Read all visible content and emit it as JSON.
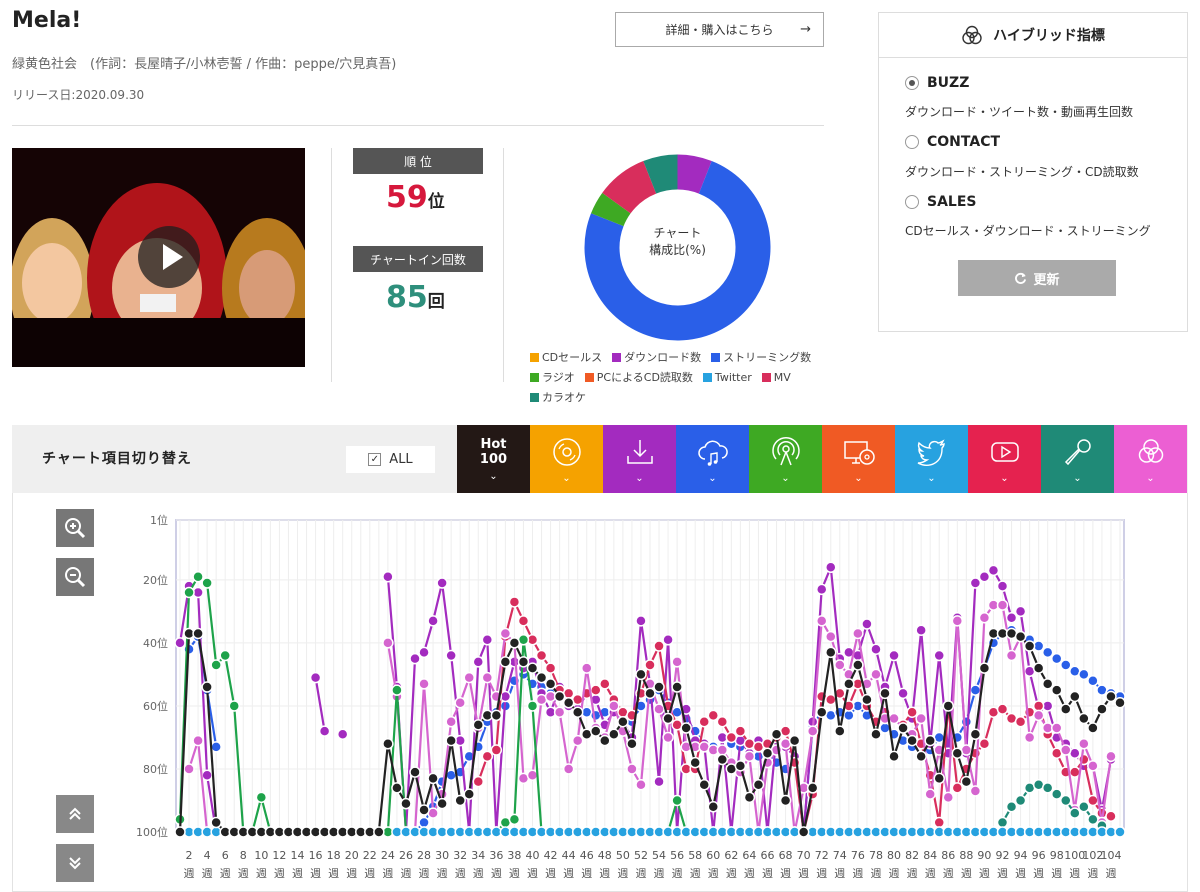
{
  "song": {
    "title": "Mela!",
    "credits": "緑黄色社会　(作詞：長屋晴子/小林壱誓 / 作曲：peppe/穴見真吾)",
    "release": "リリース日:2020.09.30",
    "detail_button": "詳細・購入はこちら",
    "detail_arrow": "→"
  },
  "stats": {
    "rank_label": "順 位",
    "rank_value": "59",
    "rank_unit": "位",
    "chartin_label": "チャートイン回数",
    "chartin_value": "85",
    "chartin_unit": "回",
    "rank_color": "#d6183c",
    "chartin_color": "#2e8f7c"
  },
  "composition": {
    "center_line1": "チャート",
    "center_line2": "構成比(%)",
    "slices": [
      {
        "name": "CDセールス",
        "value": 0,
        "color": "#f5a200"
      },
      {
        "name": "ダウンロード数",
        "value": 6,
        "color": "#a32bbf"
      },
      {
        "name": "ストリーミング数",
        "value": 75,
        "color": "#2a5fe8"
      },
      {
        "name": "ラジオ",
        "value": 4,
        "color": "#3ea923"
      },
      {
        "name": "PCによるCD読取数",
        "value": 0,
        "color": "#f05a24"
      },
      {
        "name": "Twitter",
        "value": 0,
        "color": "#27a2e0"
      },
      {
        "name": "MV",
        "value": 9,
        "color": "#d82e5c"
      },
      {
        "name": "カラオケ",
        "value": 6,
        "color": "#1f8a77"
      }
    ]
  },
  "hybrid": {
    "title": "ハイブリッド指標",
    "options": [
      {
        "label": "BUZZ",
        "desc": "ダウンロード・ツイート数・動画再生回数",
        "selected": true
      },
      {
        "label": "CONTACT",
        "desc": "ダウンロード・ストリーミング・CD読取数",
        "selected": false
      },
      {
        "label": "SALES",
        "desc": "CDセールス・ダウンロード・ストリーミング",
        "selected": false
      }
    ],
    "refresh": "更新"
  },
  "toolbar": {
    "switch_label": "チャート項目切り替え",
    "all_label": "ALL",
    "all_check": "✓",
    "hot_line1": "Hot",
    "hot_line2": "100",
    "chevron": "⌄",
    "tabs": [
      {
        "name": "hot100",
        "color": "#231815",
        "icon": "hot100"
      },
      {
        "name": "cd-sales",
        "color": "#f5a200",
        "icon": "disc-icon"
      },
      {
        "name": "download",
        "color": "#a32bbf",
        "icon": "download-icon"
      },
      {
        "name": "streaming",
        "color": "#2a5fe8",
        "icon": "cloud-music-icon"
      },
      {
        "name": "radio",
        "color": "#3ea923",
        "icon": "radio-icon"
      },
      {
        "name": "pc-cd-read",
        "color": "#f05a24",
        "icon": "pc-disc-icon"
      },
      {
        "name": "twitter",
        "color": "#27a2e0",
        "icon": "twitter-icon"
      },
      {
        "name": "mv",
        "color": "#e5224f",
        "icon": "video-play-icon"
      },
      {
        "name": "karaoke",
        "color": "#1f8a77",
        "icon": "microphone-icon"
      },
      {
        "name": "hybrid",
        "color": "#ec5fd3",
        "icon": "hybrid-icon"
      }
    ]
  },
  "chart_data": {
    "type": "line",
    "ylim": [
      100,
      1
    ],
    "y_ticks": [
      "1位",
      "20位",
      "40位",
      "60位",
      "80位",
      "100位"
    ],
    "y_tick_values": [
      1,
      20,
      40,
      60,
      80,
      100
    ],
    "x_weeks": [
      1,
      2,
      3,
      4,
      5,
      6,
      7,
      8,
      9,
      10,
      11,
      12,
      13,
      14,
      15,
      16,
      17,
      18,
      19,
      20,
      21,
      22,
      23,
      24,
      25,
      26,
      27,
      28,
      29,
      30,
      31,
      32,
      33,
      34,
      35,
      36,
      37,
      38,
      39,
      40,
      41,
      42,
      43,
      44,
      45,
      46,
      47,
      48,
      49,
      50,
      51,
      52,
      53,
      54,
      55,
      56,
      57,
      58,
      59,
      60,
      61,
      62,
      63,
      64,
      65,
      66,
      67,
      68,
      69,
      70,
      71,
      72,
      73,
      74,
      75,
      76,
      77,
      78,
      79,
      80,
      81,
      82,
      83,
      84,
      85,
      86,
      87,
      88,
      89,
      90,
      91,
      92,
      93,
      94,
      95,
      96,
      97,
      98,
      99,
      100,
      101,
      102,
      103,
      104,
      105
    ],
    "x_tick_labels": [
      "2",
      "4",
      "6",
      "8",
      "10",
      "12",
      "14",
      "16",
      "18",
      "20",
      "22",
      "24",
      "26",
      "28",
      "30",
      "32",
      "34",
      "36",
      "38",
      "40",
      "42",
      "44",
      "46",
      "48",
      "50",
      "52",
      "54",
      "56",
      "58",
      "60",
      "62",
      "64",
      "66",
      "68",
      "70",
      "72",
      "74",
      "76",
      "78",
      "80",
      "82",
      "84",
      "86",
      "88",
      "90",
      "92",
      "94",
      "96",
      "98",
      "100",
      "102",
      "104"
    ],
    "x_unit": "週",
    "series": [
      {
        "name": "ストリーミング数",
        "color": "#2a5fe8",
        "values": [
          null,
          42,
          38,
          55,
          73,
          null,
          null,
          null,
          null,
          null,
          null,
          null,
          null,
          null,
          null,
          null,
          null,
          null,
          null,
          null,
          null,
          null,
          null,
          null,
          100,
          100,
          100,
          97,
          92,
          84,
          82,
          81,
          76,
          73,
          65,
          62,
          60,
          52,
          50,
          53,
          54,
          56,
          57,
          59,
          60,
          62,
          63,
          62,
          61,
          62,
          65,
          60,
          58,
          55,
          59,
          62,
          64,
          68,
          72,
          73,
          74,
          72,
          73,
          74,
          76,
          75,
          78,
          80,
          76,
          100,
          66,
          62,
          63,
          62,
          63,
          60,
          63,
          65,
          67,
          69,
          71,
          73,
          72,
          74,
          70,
          72,
          70,
          65,
          55,
          48,
          40,
          37,
          36,
          38,
          39,
          41,
          43,
          45,
          47,
          49,
          50,
          52,
          55,
          56,
          57
        ]
      },
      {
        "name": "ダウンロード数",
        "color": "#a32bbf",
        "values": [
          40,
          22,
          24,
          82,
          100,
          null,
          null,
          null,
          null,
          null,
          null,
          null,
          null,
          null,
          null,
          51,
          68,
          null,
          69,
          null,
          null,
          null,
          null,
          19,
          54,
          100,
          45,
          43,
          33,
          21,
          44,
          71,
          100,
          46,
          39,
          100,
          57,
          46,
          48,
          46,
          56,
          62,
          54,
          60,
          61,
          56,
          58,
          66,
          62,
          65,
          70,
          33,
          53,
          84,
          39,
          100,
          61,
          71,
          72,
          100,
          70,
          100,
          71,
          75,
          71,
          100,
          69,
          73,
          76,
          100,
          65,
          23,
          16,
          45,
          43,
          44,
          34,
          42,
          54,
          44,
          56,
          64,
          36,
          72,
          44,
          75,
          32,
          75,
          21,
          19,
          17,
          22,
          32,
          30,
          49,
          61,
          60,
          70,
          72,
          75,
          79,
          79,
          93,
          77
        ]
      },
      {
        "name": "MV",
        "color": "#d82e5c",
        "values": [
          null,
          null,
          null,
          null,
          null,
          null,
          null,
          null,
          null,
          null,
          null,
          null,
          null,
          null,
          null,
          null,
          null,
          null,
          null,
          null,
          null,
          null,
          null,
          null,
          null,
          null,
          null,
          null,
          null,
          null,
          null,
          null,
          null,
          84,
          76,
          74,
          38,
          27,
          33,
          39,
          44,
          48,
          55,
          56,
          58,
          56,
          55,
          53,
          58,
          62,
          63,
          56,
          47,
          41,
          60,
          66,
          80,
          80,
          65,
          63,
          65,
          70,
          68,
          72,
          73,
          72,
          70,
          68,
          78,
          100,
          88,
          57,
          58,
          56,
          60,
          53,
          60,
          65,
          62,
          64,
          66,
          62,
          72,
          82,
          97,
          60,
          86,
          80,
          75,
          72,
          62,
          61,
          64,
          65,
          62,
          60,
          69,
          75,
          81,
          81,
          77,
          90,
          94,
          95
        ]
      },
      {
        "name": "ハイブリッド",
        "color": "#d565cf",
        "values": [
          null,
          80,
          71,
          100,
          100,
          null,
          null,
          null,
          null,
          null,
          null,
          null,
          null,
          null,
          null,
          null,
          null,
          null,
          null,
          null,
          null,
          null,
          null,
          40,
          57,
          100,
          100,
          53,
          94,
          88,
          65,
          59,
          51,
          67,
          51,
          57,
          37,
          40,
          83,
          82,
          58,
          57,
          62,
          80,
          71,
          48,
          67,
          70,
          60,
          68,
          80,
          85,
          53,
          61,
          70,
          46,
          73,
          73,
          73,
          74,
          74,
          78,
          81,
          76,
          100,
          78,
          74,
          72,
          100,
          86,
          68,
          33,
          38,
          47,
          50,
          37,
          53,
          50,
          64,
          64,
          67,
          69,
          64,
          88,
          74,
          89,
          33,
          74,
          87,
          32,
          28,
          28,
          44,
          38,
          70,
          63,
          67,
          67,
          74,
          93,
          72,
          79,
          97,
          76
        ]
      },
      {
        "name": "ラジオ",
        "color": "#1ea34a",
        "values": [
          96,
          24,
          19,
          21,
          47,
          44,
          60,
          100,
          100,
          89,
          100,
          100,
          100,
          100,
          100,
          100,
          100,
          100,
          100,
          100,
          100,
          100,
          100,
          100,
          55,
          100,
          100,
          100,
          100,
          100,
          100,
          100,
          100,
          100,
          100,
          100,
          97,
          96,
          39,
          60,
          100,
          100,
          100,
          100,
          100,
          100,
          100,
          100,
          100,
          100,
          100,
          100,
          100,
          100,
          100,
          90,
          100,
          100,
          100,
          100,
          100,
          100,
          100,
          100,
          100,
          100,
          100,
          100,
          100,
          100,
          100,
          100,
          100,
          100,
          100,
          100,
          100,
          100,
          100,
          100,
          100,
          100,
          100,
          100,
          100,
          100,
          100,
          100,
          100,
          100,
          100,
          100,
          100,
          100,
          100,
          100,
          100,
          100,
          100,
          100,
          100,
          100,
          100,
          100,
          100
        ]
      },
      {
        "name": "カラオケ",
        "color": "#1f8a77",
        "values": [
          null,
          null,
          null,
          null,
          null,
          null,
          null,
          null,
          null,
          null,
          null,
          null,
          null,
          null,
          null,
          null,
          null,
          null,
          null,
          null,
          null,
          null,
          null,
          null,
          null,
          null,
          null,
          null,
          null,
          null,
          null,
          null,
          null,
          null,
          null,
          null,
          null,
          null,
          null,
          null,
          null,
          null,
          null,
          null,
          null,
          null,
          null,
          null,
          null,
          null,
          null,
          null,
          null,
          null,
          null,
          null,
          null,
          null,
          null,
          null,
          null,
          null,
          null,
          null,
          null,
          null,
          null,
          null,
          null,
          null,
          null,
          null,
          null,
          null,
          null,
          null,
          null,
          null,
          null,
          null,
          null,
          null,
          null,
          null,
          null,
          null,
          null,
          null,
          null,
          null,
          null,
          97,
          92,
          90,
          86,
          85,
          86,
          88,
          90,
          94,
          92,
          96,
          98,
          100,
          null
        ]
      },
      {
        "name": "Twitter",
        "color": "#27a2e0",
        "values": [
          100,
          100,
          100,
          100,
          100,
          100,
          null,
          null,
          null,
          null,
          null,
          null,
          null,
          null,
          null,
          null,
          null,
          null,
          null,
          null,
          null,
          null,
          null,
          null,
          100,
          100,
          100,
          100,
          100,
          100,
          100,
          100,
          100,
          100,
          100,
          100,
          100,
          100,
          100,
          100,
          100,
          100,
          100,
          100,
          100,
          100,
          100,
          100,
          100,
          100,
          100,
          100,
          100,
          100,
          100,
          100,
          100,
          100,
          100,
          100,
          100,
          100,
          100,
          100,
          100,
          100,
          100,
          100,
          100,
          100,
          100,
          100,
          100,
          100,
          100,
          100,
          100,
          100,
          100,
          100,
          100,
          100,
          100,
          100,
          100,
          100,
          100,
          100,
          100,
          100,
          100,
          100,
          100,
          100,
          100,
          100,
          100,
          100,
          100,
          100,
          100,
          100,
          100,
          100,
          100
        ]
      },
      {
        "name": "Hot 100",
        "color": "#222222",
        "values": [
          100,
          37,
          37,
          54,
          97,
          100,
          100,
          100,
          100,
          100,
          100,
          100,
          100,
          100,
          100,
          100,
          100,
          100,
          100,
          100,
          100,
          100,
          100,
          72,
          86,
          91,
          81,
          93,
          83,
          91,
          71,
          90,
          88,
          66,
          63,
          63,
          46,
          40,
          46,
          48,
          51,
          53,
          57,
          59,
          62,
          69,
          68,
          71,
          69,
          65,
          72,
          50,
          56,
          54,
          64,
          54,
          67,
          78,
          85,
          92,
          77,
          80,
          79,
          89,
          85,
          75,
          69,
          90,
          71,
          100,
          86,
          62,
          43,
          68,
          53,
          47,
          58,
          69,
          56,
          76,
          67,
          71,
          76,
          71,
          83,
          60,
          75,
          84,
          69,
          48,
          37,
          37,
          37,
          38,
          41,
          48,
          53,
          55,
          61,
          57,
          64,
          67,
          61,
          57,
          59
        ]
      }
    ]
  }
}
